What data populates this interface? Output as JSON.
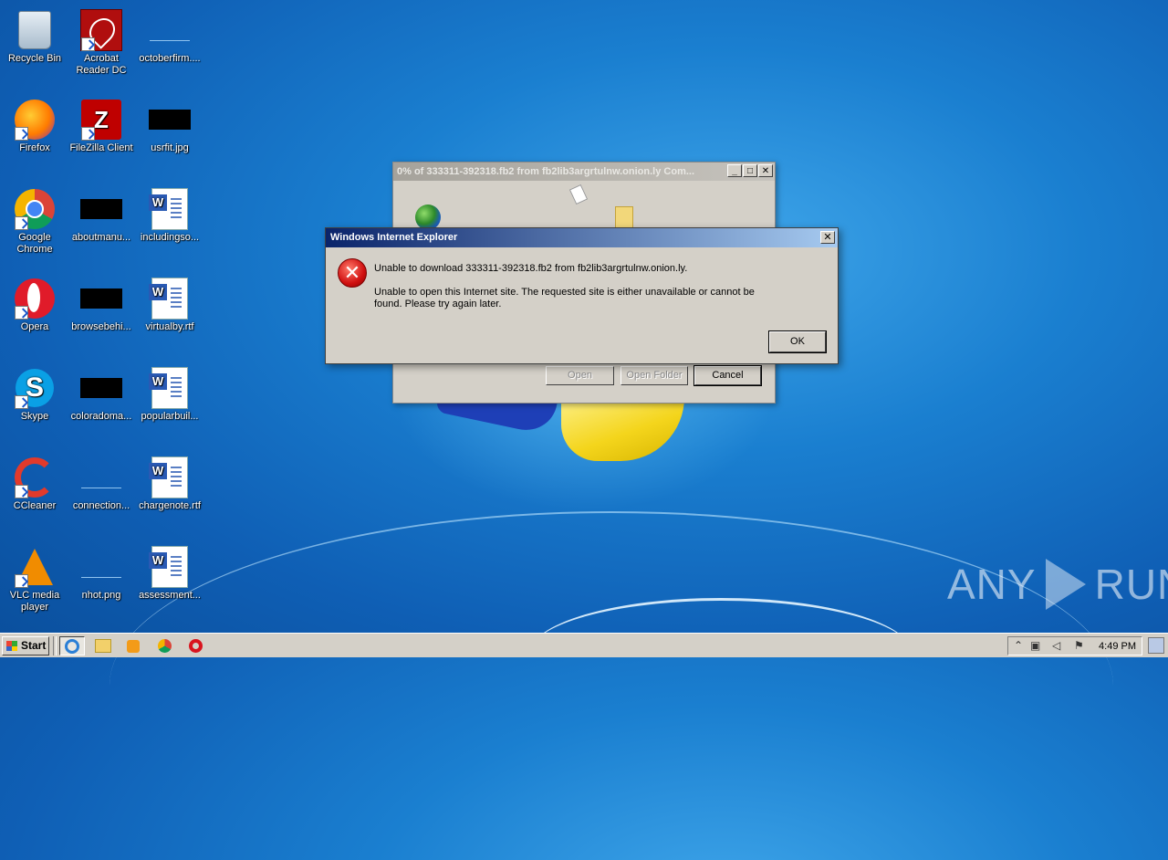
{
  "desktop": {
    "icons": [
      {
        "label": "Recycle Bin",
        "icon": "recycle-bin-icon"
      },
      {
        "label": "Acrobat Reader DC",
        "icon": "acrobat-reader-icon"
      },
      {
        "label": "octoberfirm....",
        "icon": "file-icon"
      },
      {
        "label": "Firefox",
        "icon": "firefox-icon"
      },
      {
        "label": "FileZilla Client",
        "icon": "filezilla-icon"
      },
      {
        "label": "usrfit.jpg",
        "icon": "image-file-icon"
      },
      {
        "label": "Google Chrome",
        "icon": "chrome-icon"
      },
      {
        "label": "aboutmanu...",
        "icon": "file-icon"
      },
      {
        "label": "includingso...",
        "icon": "word-document-icon"
      },
      {
        "label": "Opera",
        "icon": "opera-icon"
      },
      {
        "label": "browsebehi...",
        "icon": "file-icon"
      },
      {
        "label": "virtualby.rtf",
        "icon": "word-document-icon"
      },
      {
        "label": "Skype",
        "icon": "skype-icon"
      },
      {
        "label": "coloradoma...",
        "icon": "file-icon"
      },
      {
        "label": "popularbuil...",
        "icon": "word-document-icon"
      },
      {
        "label": "CCleaner",
        "icon": "ccleaner-icon"
      },
      {
        "label": "connection...",
        "icon": "file-icon"
      },
      {
        "label": "chargenote.rtf",
        "icon": "word-document-icon"
      },
      {
        "label": "VLC media player",
        "icon": "vlc-icon"
      },
      {
        "label": "nhot.png",
        "icon": "image-file-icon"
      },
      {
        "label": "assessment...",
        "icon": "word-document-icon"
      }
    ]
  },
  "download_window": {
    "title": "0% of 333311-392318.fb2 from fb2lib3argrtulnw.onion.ly Com...",
    "buttons": {
      "open": "Open",
      "open_folder": "Open Folder",
      "cancel": "Cancel"
    },
    "title_buttons": {
      "minimize": "_",
      "maximize": "□",
      "close": "✕"
    }
  },
  "error_dialog": {
    "title": "Windows Internet Explorer",
    "message_line1": "Unable to download 333311-392318.fb2 from fb2lib3argrtulnw.onion.ly.",
    "message_line2": "Unable to open this Internet site.  The requested site is either unavailable or cannot be found.  Please try again later.",
    "ok_label": "OK",
    "close_glyph": "✕",
    "icon_glyph": "✕"
  },
  "watermark": {
    "left": "ANY",
    "right": "RUN"
  },
  "taskbar": {
    "start_label": "Start",
    "quick_launch": [
      "ie-icon",
      "folder-icon",
      "media-player-icon",
      "chrome-icon",
      "opera-icon"
    ],
    "tray_icons": [
      "show-hidden-icon",
      "network-icon",
      "volume-icon",
      "flag-icon"
    ],
    "clock": "4:49 PM"
  },
  "colors": {
    "desktop_blue": "#1a7fd0",
    "active_title_start": "#0a246a",
    "active_title_end": "#a6caf0",
    "error_red": "#d01010"
  }
}
